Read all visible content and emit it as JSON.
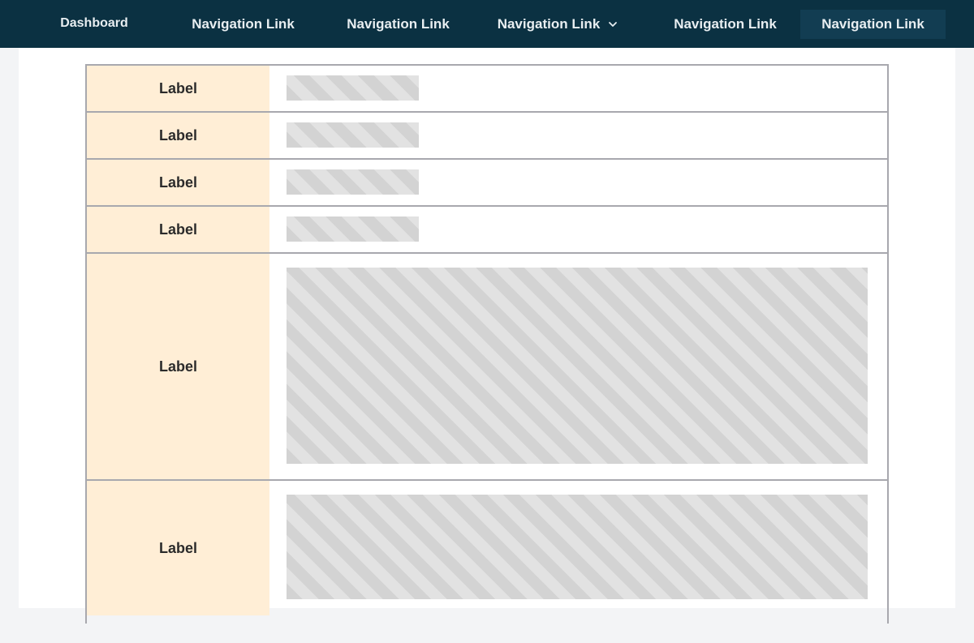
{
  "nav": {
    "dashboard": "Dashboard",
    "links": [
      {
        "label": "Navigation Link"
      },
      {
        "label": "Navigation Link"
      },
      {
        "label": "Navigation Link",
        "has_dropdown": true,
        "icon": "chevron-down-icon"
      },
      {
        "label": "Navigation Link"
      },
      {
        "label": "Navigation Link",
        "active": true
      }
    ]
  },
  "form": {
    "rows": [
      {
        "label": "Label"
      },
      {
        "label": "Label"
      },
      {
        "label": "Label"
      },
      {
        "label": "Label"
      },
      {
        "label": "Label"
      },
      {
        "label": "Label"
      }
    ]
  },
  "colors": {
    "nav_background": "#0b3142",
    "nav_active": "#123d52",
    "label_background": "#ffeed6",
    "border": "#a8a8ae",
    "placeholder": "#d6d6d6"
  }
}
